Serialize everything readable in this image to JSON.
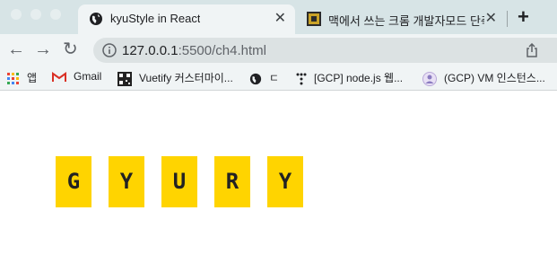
{
  "browser": {
    "tabs": [
      {
        "title": "kyuStyle in React",
        "active": true
      },
      {
        "title": "맥에서 쓰는 크롬 개발자모드 단축키",
        "active": false
      }
    ],
    "url_host": "127.0.0.1",
    "url_rest": ":5500/ch4.html",
    "bookmarks": [
      {
        "label": "앱",
        "icon": "apps-grid-icon"
      },
      {
        "label": "Gmail",
        "icon": "gmail-icon"
      },
      {
        "label": "Vuetify 커스터마이...",
        "icon": "qr-icon"
      },
      {
        "label": "ㄷ",
        "icon": "globe-icon"
      },
      {
        "label": "[GCP] node.js 웹...",
        "icon": "dots-icon"
      },
      {
        "label": "(GCP) VM 인스턴스...",
        "icon": "avatar-icon"
      }
    ]
  },
  "page": {
    "letters": [
      "G",
      "Y",
      "U",
      "R",
      "Y"
    ],
    "letter_bg": "#ffd400"
  }
}
